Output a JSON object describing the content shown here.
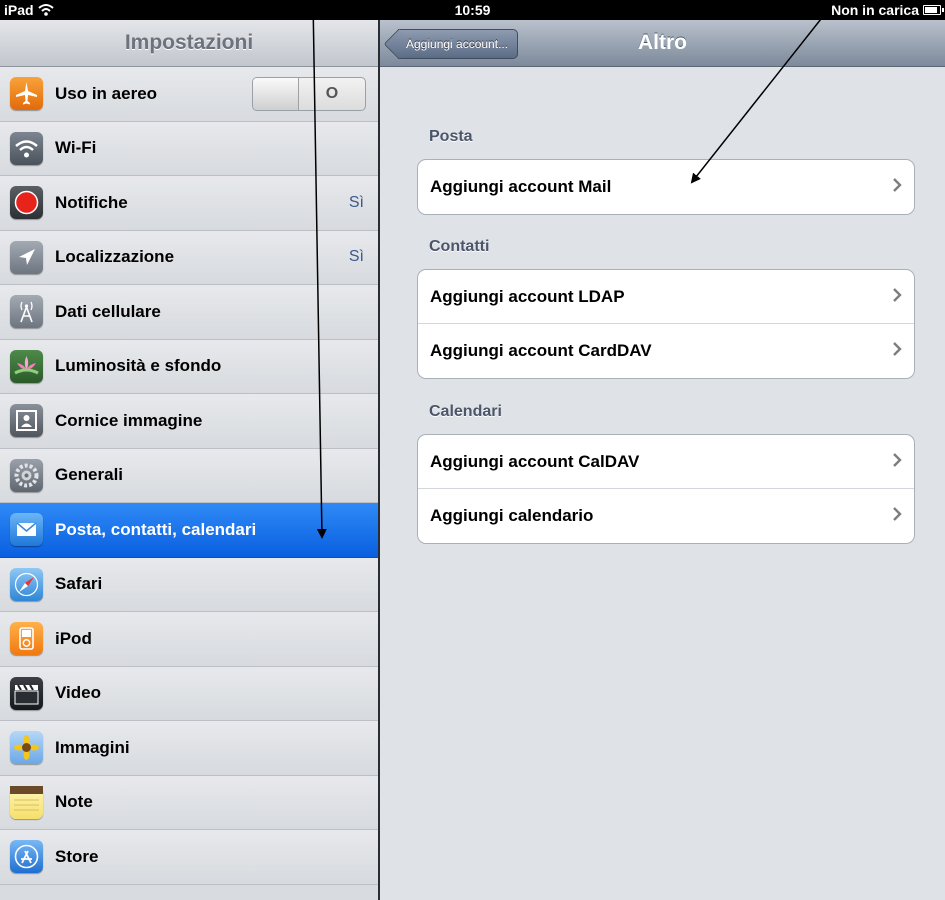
{
  "status_bar": {
    "carrier": "iPad",
    "time": "10:59",
    "battery_text": "Non in carica"
  },
  "sidebar": {
    "title": "Impostazioni",
    "airplane_toggle_state": "O",
    "items": [
      {
        "label": "Uso in aereo",
        "value": "",
        "icon": "airplane-icon"
      },
      {
        "label": "Wi-Fi",
        "value": "",
        "icon": "wifi-icon"
      },
      {
        "label": "Notifiche",
        "value": "Sì",
        "icon": "notifications-icon"
      },
      {
        "label": "Localizzazione",
        "value": "Sì",
        "icon": "location-icon"
      },
      {
        "label": "Dati cellulare",
        "value": "",
        "icon": "cellular-data-icon"
      },
      {
        "label": "Luminosità e sfondo",
        "value": "",
        "icon": "brightness-wallpaper-icon"
      },
      {
        "label": "Cornice immagine",
        "value": "",
        "icon": "picture-frame-icon"
      },
      {
        "label": "Generali",
        "value": "",
        "icon": "general-gear-icon"
      },
      {
        "label": "Posta, contatti, calendari",
        "value": "",
        "icon": "mail-icon",
        "selected": true
      },
      {
        "label": "Safari",
        "value": "",
        "icon": "safari-compass-icon"
      },
      {
        "label": "iPod",
        "value": "",
        "icon": "ipod-icon"
      },
      {
        "label": "Video",
        "value": "",
        "icon": "video-clapper-icon"
      },
      {
        "label": "Immagini",
        "value": "",
        "icon": "photos-sunflower-icon"
      },
      {
        "label": "Note",
        "value": "",
        "icon": "notes-icon"
      },
      {
        "label": "Store",
        "value": "",
        "icon": "app-store-icon"
      }
    ]
  },
  "detail": {
    "back_label": "Aggiungi account...",
    "title": "Altro",
    "sections": [
      {
        "header": "Posta",
        "rows": [
          "Aggiungi account Mail"
        ]
      },
      {
        "header": "Contatti",
        "rows": [
          "Aggiungi account LDAP",
          "Aggiungi account CardDAV"
        ]
      },
      {
        "header": "Calendari",
        "rows": [
          "Aggiungi account CalDAV",
          "Aggiungi calendario"
        ]
      }
    ]
  },
  "colors": {
    "selected_row": "#0a5fe0",
    "navbar_right": "#7d8a9b",
    "value_text": "#3a5a8a"
  }
}
